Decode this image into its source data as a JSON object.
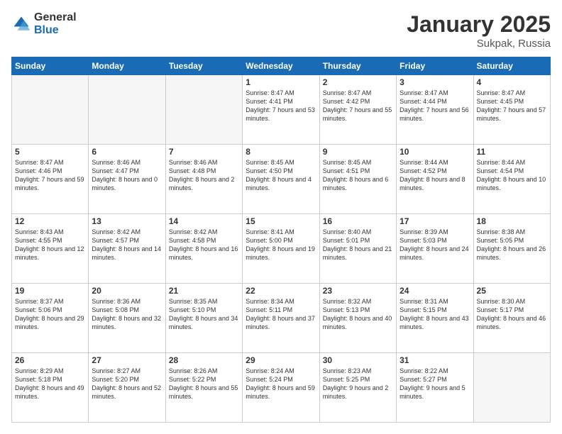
{
  "logo": {
    "general": "General",
    "blue": "Blue"
  },
  "title": "January 2025",
  "subtitle": "Sukpak, Russia",
  "days": [
    "Sunday",
    "Monday",
    "Tuesday",
    "Wednesday",
    "Thursday",
    "Friday",
    "Saturday"
  ],
  "weeks": [
    [
      {
        "day": "",
        "sunrise": "",
        "sunset": "",
        "daylight": ""
      },
      {
        "day": "",
        "sunrise": "",
        "sunset": "",
        "daylight": ""
      },
      {
        "day": "",
        "sunrise": "",
        "sunset": "",
        "daylight": ""
      },
      {
        "day": "1",
        "sunrise": "Sunrise: 8:47 AM",
        "sunset": "Sunset: 4:41 PM",
        "daylight": "Daylight: 7 hours and 53 minutes."
      },
      {
        "day": "2",
        "sunrise": "Sunrise: 8:47 AM",
        "sunset": "Sunset: 4:42 PM",
        "daylight": "Daylight: 7 hours and 55 minutes."
      },
      {
        "day": "3",
        "sunrise": "Sunrise: 8:47 AM",
        "sunset": "Sunset: 4:44 PM",
        "daylight": "Daylight: 7 hours and 56 minutes."
      },
      {
        "day": "4",
        "sunrise": "Sunrise: 8:47 AM",
        "sunset": "Sunset: 4:45 PM",
        "daylight": "Daylight: 7 hours and 57 minutes."
      }
    ],
    [
      {
        "day": "5",
        "sunrise": "Sunrise: 8:47 AM",
        "sunset": "Sunset: 4:46 PM",
        "daylight": "Daylight: 7 hours and 59 minutes."
      },
      {
        "day": "6",
        "sunrise": "Sunrise: 8:46 AM",
        "sunset": "Sunset: 4:47 PM",
        "daylight": "Daylight: 8 hours and 0 minutes."
      },
      {
        "day": "7",
        "sunrise": "Sunrise: 8:46 AM",
        "sunset": "Sunset: 4:48 PM",
        "daylight": "Daylight: 8 hours and 2 minutes."
      },
      {
        "day": "8",
        "sunrise": "Sunrise: 8:45 AM",
        "sunset": "Sunset: 4:50 PM",
        "daylight": "Daylight: 8 hours and 4 minutes."
      },
      {
        "day": "9",
        "sunrise": "Sunrise: 8:45 AM",
        "sunset": "Sunset: 4:51 PM",
        "daylight": "Daylight: 8 hours and 6 minutes."
      },
      {
        "day": "10",
        "sunrise": "Sunrise: 8:44 AM",
        "sunset": "Sunset: 4:52 PM",
        "daylight": "Daylight: 8 hours and 8 minutes."
      },
      {
        "day": "11",
        "sunrise": "Sunrise: 8:44 AM",
        "sunset": "Sunset: 4:54 PM",
        "daylight": "Daylight: 8 hours and 10 minutes."
      }
    ],
    [
      {
        "day": "12",
        "sunrise": "Sunrise: 8:43 AM",
        "sunset": "Sunset: 4:55 PM",
        "daylight": "Daylight: 8 hours and 12 minutes."
      },
      {
        "day": "13",
        "sunrise": "Sunrise: 8:42 AM",
        "sunset": "Sunset: 4:57 PM",
        "daylight": "Daylight: 8 hours and 14 minutes."
      },
      {
        "day": "14",
        "sunrise": "Sunrise: 8:42 AM",
        "sunset": "Sunset: 4:58 PM",
        "daylight": "Daylight: 8 hours and 16 minutes."
      },
      {
        "day": "15",
        "sunrise": "Sunrise: 8:41 AM",
        "sunset": "Sunset: 5:00 PM",
        "daylight": "Daylight: 8 hours and 19 minutes."
      },
      {
        "day": "16",
        "sunrise": "Sunrise: 8:40 AM",
        "sunset": "Sunset: 5:01 PM",
        "daylight": "Daylight: 8 hours and 21 minutes."
      },
      {
        "day": "17",
        "sunrise": "Sunrise: 8:39 AM",
        "sunset": "Sunset: 5:03 PM",
        "daylight": "Daylight: 8 hours and 24 minutes."
      },
      {
        "day": "18",
        "sunrise": "Sunrise: 8:38 AM",
        "sunset": "Sunset: 5:05 PM",
        "daylight": "Daylight: 8 hours and 26 minutes."
      }
    ],
    [
      {
        "day": "19",
        "sunrise": "Sunrise: 8:37 AM",
        "sunset": "Sunset: 5:06 PM",
        "daylight": "Daylight: 8 hours and 29 minutes."
      },
      {
        "day": "20",
        "sunrise": "Sunrise: 8:36 AM",
        "sunset": "Sunset: 5:08 PM",
        "daylight": "Daylight: 8 hours and 32 minutes."
      },
      {
        "day": "21",
        "sunrise": "Sunrise: 8:35 AM",
        "sunset": "Sunset: 5:10 PM",
        "daylight": "Daylight: 8 hours and 34 minutes."
      },
      {
        "day": "22",
        "sunrise": "Sunrise: 8:34 AM",
        "sunset": "Sunset: 5:11 PM",
        "daylight": "Daylight: 8 hours and 37 minutes."
      },
      {
        "day": "23",
        "sunrise": "Sunrise: 8:32 AM",
        "sunset": "Sunset: 5:13 PM",
        "daylight": "Daylight: 8 hours and 40 minutes."
      },
      {
        "day": "24",
        "sunrise": "Sunrise: 8:31 AM",
        "sunset": "Sunset: 5:15 PM",
        "daylight": "Daylight: 8 hours and 43 minutes."
      },
      {
        "day": "25",
        "sunrise": "Sunrise: 8:30 AM",
        "sunset": "Sunset: 5:17 PM",
        "daylight": "Daylight: 8 hours and 46 minutes."
      }
    ],
    [
      {
        "day": "26",
        "sunrise": "Sunrise: 8:29 AM",
        "sunset": "Sunset: 5:18 PM",
        "daylight": "Daylight: 8 hours and 49 minutes."
      },
      {
        "day": "27",
        "sunrise": "Sunrise: 8:27 AM",
        "sunset": "Sunset: 5:20 PM",
        "daylight": "Daylight: 8 hours and 52 minutes."
      },
      {
        "day": "28",
        "sunrise": "Sunrise: 8:26 AM",
        "sunset": "Sunset: 5:22 PM",
        "daylight": "Daylight: 8 hours and 55 minutes."
      },
      {
        "day": "29",
        "sunrise": "Sunrise: 8:24 AM",
        "sunset": "Sunset: 5:24 PM",
        "daylight": "Daylight: 8 hours and 59 minutes."
      },
      {
        "day": "30",
        "sunrise": "Sunrise: 8:23 AM",
        "sunset": "Sunset: 5:25 PM",
        "daylight": "Daylight: 9 hours and 2 minutes."
      },
      {
        "day": "31",
        "sunrise": "Sunrise: 8:22 AM",
        "sunset": "Sunset: 5:27 PM",
        "daylight": "Daylight: 9 hours and 5 minutes."
      },
      {
        "day": "",
        "sunrise": "",
        "sunset": "",
        "daylight": ""
      }
    ]
  ]
}
